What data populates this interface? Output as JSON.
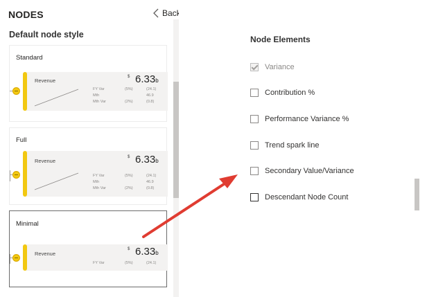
{
  "header": {
    "title": "NODES",
    "back_label": "Back"
  },
  "left": {
    "section_title": "Default node style",
    "cards": [
      {
        "label": "Standard",
        "node": {
          "name": "Revenue",
          "currency": "$",
          "value": "6.33",
          "unit": "b",
          "metrics": [
            {
              "label": "FY Var",
              "pct": "(5%)",
              "val": "(24.1)"
            },
            {
              "label": "Mth",
              "pct": "",
              "val": "46.9"
            },
            {
              "label": "Mth Var",
              "pct": "(2%)",
              "val": "(0.8)"
            }
          ]
        }
      },
      {
        "label": "Full",
        "node": {
          "name": "Revenue",
          "currency": "$",
          "value": "6.33",
          "unit": "b",
          "metrics": [
            {
              "label": "FY Var",
              "pct": "(5%)",
              "val": "(24.1)"
            },
            {
              "label": "Mth",
              "pct": "",
              "val": "46.9"
            },
            {
              "label": "Mth Var",
              "pct": "(2%)",
              "val": "(0.8)"
            }
          ]
        }
      },
      {
        "label": "Minimal",
        "selected": true,
        "node": {
          "name": "Revenue",
          "currency": "$",
          "value": "6.33",
          "unit": "b",
          "metrics": [
            {
              "label": "FY Var",
              "pct": "(5%)",
              "val": "(24.1)"
            }
          ]
        }
      }
    ]
  },
  "right": {
    "title": "Node Elements",
    "items": [
      {
        "label": "Variance",
        "checked": true,
        "disabled": true
      },
      {
        "label": "Contribution %",
        "checked": false
      },
      {
        "label": "Performance Variance %",
        "checked": false
      },
      {
        "label": "Trend spark line",
        "checked": false
      },
      {
        "label": "Secondary Value/Variance",
        "checked": false
      },
      {
        "label": "Descendant Node Count",
        "checked": false
      }
    ]
  },
  "colors": {
    "node_accent": "#f2c811",
    "arrow": "#e03c31",
    "selected_border": "#6b6b6b"
  },
  "icons": {
    "back": "chevron-left-icon",
    "node_connector": "node-dot-icon",
    "sparkline": "sparkline-icon"
  }
}
